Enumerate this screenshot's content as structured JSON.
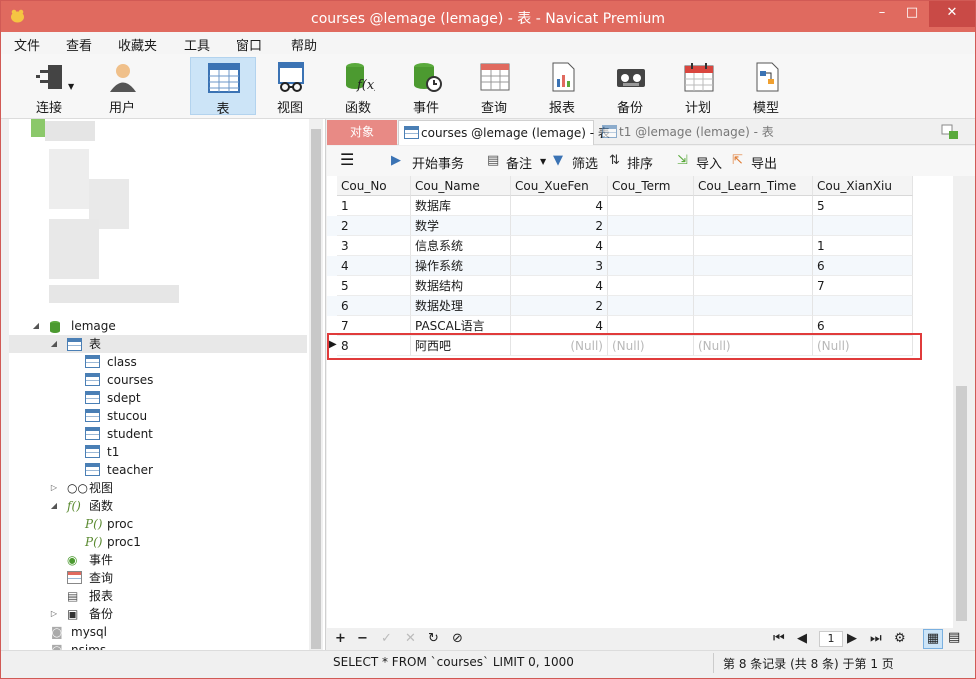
{
  "window": {
    "title": "courses @lemage (lemage) - 表 - Navicat Premium",
    "minimize": "–",
    "maximize": "□",
    "close": "✕"
  },
  "menu": [
    "文件",
    "查看",
    "收藏夹",
    "工具",
    "窗口",
    "帮助"
  ],
  "toolbar": [
    "连接",
    "用户",
    "表",
    "视图",
    "函数",
    "事件",
    "查询",
    "报表",
    "备份",
    "计划",
    "模型"
  ],
  "tree": {
    "db": "lemage",
    "tables_group": "表",
    "tables": [
      "class",
      "courses",
      "sdept",
      "stucou",
      "student",
      "t1",
      "teacher"
    ],
    "views_group": "视图",
    "functions_group": "函数",
    "functions": [
      "proc",
      "proc1"
    ],
    "events": "事件",
    "queries": "查询",
    "reports": "报表",
    "backups": "备份",
    "other_dbs": [
      "mysql",
      "nsims"
    ]
  },
  "tabs": {
    "objects": "对象",
    "active": "courses @lemage (lemage) - 表",
    "inactive": "t1 @lemage (lemage) - 表"
  },
  "datatools": {
    "begin_tx": "开始事务",
    "memo": "备注",
    "filter": "筛选",
    "sort": "排序",
    "import": "导入",
    "export": "导出"
  },
  "grid": {
    "columns": [
      "Cou_No",
      "Cou_Name",
      "Cou_XueFen",
      "Cou_Term",
      "Cou_Learn_Time",
      "Cou_XianXiu"
    ],
    "rows": [
      [
        "1",
        "数据库",
        "4",
        "",
        "",
        "5"
      ],
      [
        "2",
        "数学",
        "2",
        "",
        "",
        ""
      ],
      [
        "3",
        "信息系统",
        "4",
        "",
        "",
        "1"
      ],
      [
        "4",
        "操作系统",
        "3",
        "",
        "",
        "6"
      ],
      [
        "5",
        "数据结构",
        "4",
        "",
        "",
        "7"
      ],
      [
        "6",
        "数据处理",
        "2",
        "",
        "",
        ""
      ],
      [
        "7",
        "PASCAL语言",
        "4",
        "",
        "",
        "6"
      ],
      [
        "8",
        "阿西吧",
        "(Null)",
        "(Null)",
        "(Null)",
        "(Null)"
      ]
    ]
  },
  "pager": {
    "page": "1"
  },
  "status": {
    "sql": "SELECT * FROM `courses` LIMIT 0, 1000",
    "records": "第 8 条记录 (共 8 条) 于第 1 页"
  },
  "colors": {
    "titlebar": "#e06a5f",
    "accent_tab": "#e88a85",
    "highlight": "#e03b3b"
  }
}
